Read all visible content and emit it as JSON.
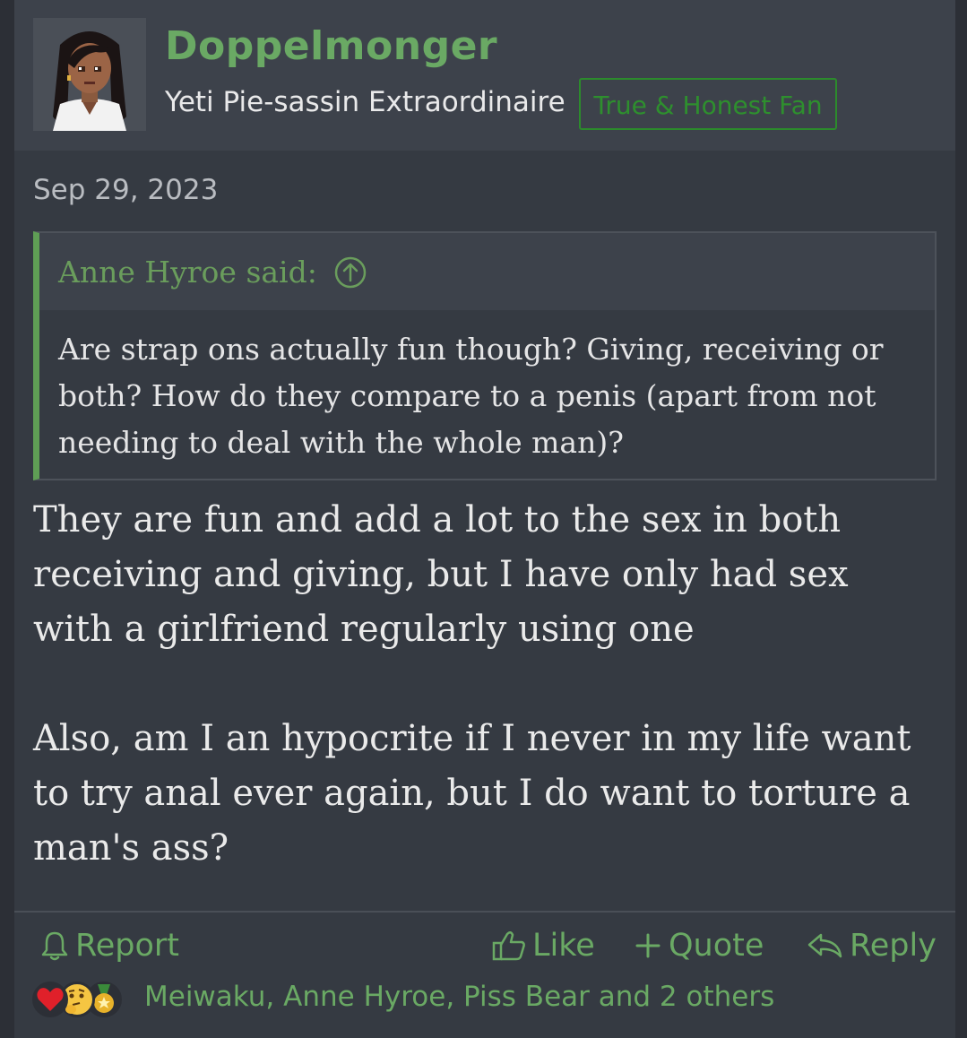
{
  "post": {
    "username": "Doppelmonger",
    "user_title": "Yeti Pie-sassin Extraordinaire",
    "user_banner": "True & Honest Fan",
    "date": "Sep 29, 2023",
    "quote": {
      "attribution": "Anne Hyroe said:",
      "text": "Are strap ons actually fun though? Giving, receiving or both? How do they compare to a penis (apart from not needing to deal with the whole man)?"
    },
    "message": {
      "paragraph_1": "They are fun and add a lot to the sex in both receiving and giving, but I have only had sex with a girlfriend regularly using one",
      "paragraph_2": "Also, am I an hypocrite if I never in my life want to try anal ever again, but I do want to torture a man's ass?"
    },
    "actions": {
      "report": "Report",
      "like": "Like",
      "quote": "Quote",
      "reply": "Reply"
    },
    "reactions": {
      "icons": [
        "heart-icon",
        "thinking-face-icon",
        "medal-icon"
      ],
      "summary": "Meiwaku, Anne Hyroe, Piss Bear and 2 others"
    },
    "colors": {
      "accent_green": "#6aa964",
      "banner_green": "#2e8f2e",
      "quote_bar": "#5f9e55",
      "background": "#353a42"
    }
  }
}
